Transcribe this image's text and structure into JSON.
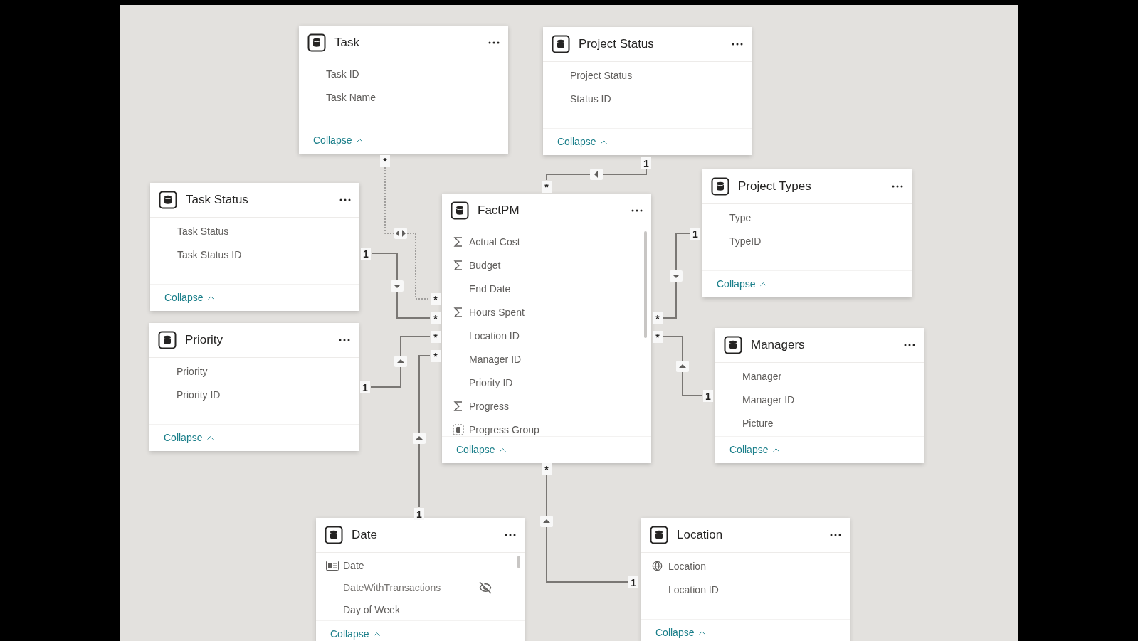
{
  "tables": [
    {
      "name": "Task",
      "fields": [
        {
          "name": "Task ID",
          "kind": "plain",
          "hidden": false
        },
        {
          "name": "Task Name",
          "kind": "plain",
          "hidden": false
        }
      ],
      "collapse": "Collapse"
    },
    {
      "name": "Project Status",
      "fields": [
        {
          "name": "Project Status",
          "kind": "plain",
          "hidden": false
        },
        {
          "name": "Status ID",
          "kind": "plain",
          "hidden": false
        }
      ],
      "collapse": "Collapse"
    },
    {
      "name": "Task Status",
      "fields": [
        {
          "name": "Task Status",
          "kind": "plain",
          "hidden": false
        },
        {
          "name": "Task Status ID",
          "kind": "plain",
          "hidden": false
        }
      ],
      "collapse": "Collapse"
    },
    {
      "name": "FactPM",
      "fields": [
        {
          "name": "Actual Cost",
          "kind": "sum",
          "hidden": false
        },
        {
          "name": "Budget",
          "kind": "sum",
          "hidden": false
        },
        {
          "name": "End Date",
          "kind": "plain",
          "hidden": false
        },
        {
          "name": "Hours Spent",
          "kind": "sum",
          "hidden": false
        },
        {
          "name": "Location ID",
          "kind": "plain",
          "hidden": false
        },
        {
          "name": "Manager ID",
          "kind": "plain",
          "hidden": false
        },
        {
          "name": "Priority ID",
          "kind": "plain",
          "hidden": false
        },
        {
          "name": "Progress",
          "kind": "sum",
          "hidden": false
        },
        {
          "name": "Progress Group",
          "kind": "group",
          "hidden": false
        }
      ],
      "collapse": "Collapse"
    },
    {
      "name": "Project Types",
      "fields": [
        {
          "name": "Type",
          "kind": "plain",
          "hidden": false
        },
        {
          "name": "TypeID",
          "kind": "plain",
          "hidden": false
        }
      ],
      "collapse": "Collapse"
    },
    {
      "name": "Priority",
      "fields": [
        {
          "name": "Priority",
          "kind": "plain",
          "hidden": false
        },
        {
          "name": "Priority ID",
          "kind": "plain",
          "hidden": false
        }
      ],
      "collapse": "Collapse"
    },
    {
      "name": "Managers",
      "fields": [
        {
          "name": "Manager",
          "kind": "plain",
          "hidden": false
        },
        {
          "name": "Manager ID",
          "kind": "plain",
          "hidden": false
        },
        {
          "name": "Picture",
          "kind": "plain",
          "hidden": false
        }
      ],
      "collapse": "Collapse"
    },
    {
      "name": "Date",
      "fields": [
        {
          "name": "Date",
          "kind": "calendar",
          "hidden": false
        },
        {
          "name": "DateWithTransactions",
          "kind": "plain",
          "hidden": true
        },
        {
          "name": "Day of Week",
          "kind": "plain",
          "hidden": false
        }
      ],
      "collapse": "Collapse"
    },
    {
      "name": "Location",
      "fields": [
        {
          "name": "Location",
          "kind": "globe",
          "hidden": false
        },
        {
          "name": "Location ID",
          "kind": "plain",
          "hidden": false
        }
      ],
      "collapse": "Collapse"
    }
  ],
  "relationships": [
    {
      "end_labels": [
        "*",
        "*"
      ],
      "kind": "bidirectional",
      "active": false
    },
    {
      "end_labels": [
        "1",
        "*"
      ],
      "kind": "single",
      "active": true
    },
    {
      "end_labels": [
        "1",
        "*"
      ],
      "kind": "single",
      "active": true
    },
    {
      "end_labels": [
        "1",
        "*"
      ],
      "kind": "single",
      "active": true
    },
    {
      "end_labels": [
        "1",
        "*"
      ],
      "kind": "single",
      "active": true
    },
    {
      "end_labels": [
        "1",
        "*"
      ],
      "kind": "single",
      "active": true
    },
    {
      "end_labels": [
        "1",
        "*"
      ],
      "kind": "single",
      "active": true
    },
    {
      "end_labels": [
        "1",
        "*"
      ],
      "kind": "single",
      "active": true
    }
  ]
}
